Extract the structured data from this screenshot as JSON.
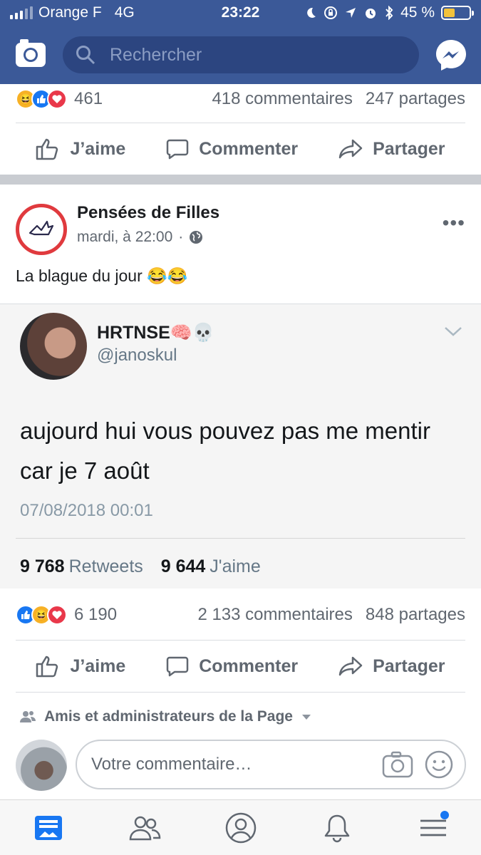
{
  "status_bar": {
    "carrier": "Orange F",
    "network": "4G",
    "time": "23:22",
    "battery": "45 %"
  },
  "nav": {
    "search_placeholder": "Rechercher"
  },
  "post1": {
    "reactions_count": "461",
    "comments": "418 commentaires",
    "shares": "247 partages"
  },
  "actions": {
    "like": "J’aime",
    "comment": "Commenter",
    "share": "Partager"
  },
  "post2": {
    "page_name": "Pensées de Filles",
    "time": "mardi, à 22:00",
    "dot": "·",
    "text": "La blague du jour 😂😂",
    "more": "•••",
    "tweet": {
      "name": "HRTNSE🧠💀",
      "handle": "@janoskul",
      "body": "aujourd hui vous pouvez pas me mentir car je 7 août",
      "date": "07/08/2018 00:01",
      "retweets_num": "9 768",
      "retweets_label": "Retweets",
      "likes_num": "9 644",
      "likes_label": "J'aime"
    },
    "reactions_count": "6 190",
    "comments": "2 133 commentaires",
    "shares": "848 partages"
  },
  "audience": "Amis et administrateurs de la Page",
  "comment_placeholder": "Votre commentaire…",
  "colors": {
    "brand": "#3b5998",
    "notification_dot": "#1877f2",
    "page_ring": "#e03a3e"
  }
}
